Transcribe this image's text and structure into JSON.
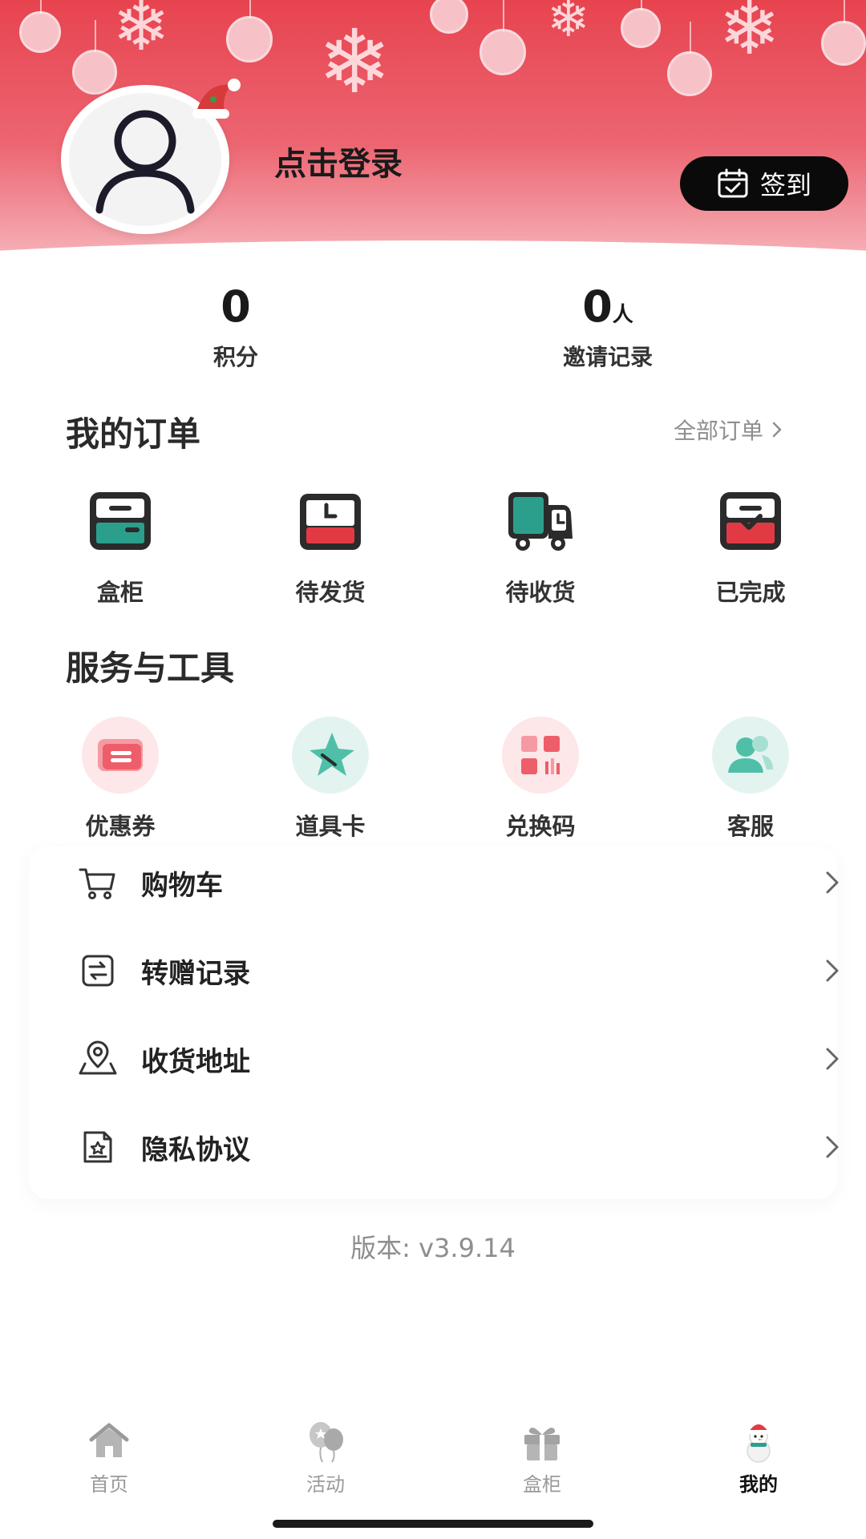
{
  "header": {
    "login_text": "点击登录",
    "checkin_label": "签到"
  },
  "stats": [
    {
      "value": "0",
      "unit": "",
      "label": "积分"
    },
    {
      "value": "0",
      "unit": "人",
      "label": "邀请记录"
    }
  ],
  "orders": {
    "title": "我的订单",
    "all_link": "全部订单",
    "items": [
      {
        "label": "盒柜",
        "icon": "box-cabinet-icon"
      },
      {
        "label": "待发货",
        "icon": "pending-ship-icon"
      },
      {
        "label": "待收货",
        "icon": "delivery-truck-icon"
      },
      {
        "label": "已完成",
        "icon": "completed-box-icon"
      }
    ]
  },
  "services": {
    "title": "服务与工具",
    "items": [
      {
        "label": "优惠券",
        "icon": "coupon-icon"
      },
      {
        "label": "道具卡",
        "icon": "prop-card-icon"
      },
      {
        "label": "兑换码",
        "icon": "redeem-code-icon"
      },
      {
        "label": "客服",
        "icon": "customer-service-icon"
      }
    ]
  },
  "menu": [
    {
      "label": "购物车",
      "icon": "cart-icon"
    },
    {
      "label": "转赠记录",
      "icon": "transfer-icon"
    },
    {
      "label": "收货地址",
      "icon": "location-icon"
    },
    {
      "label": "隐私协议",
      "icon": "privacy-icon"
    }
  ],
  "version": "版本: v3.9.14",
  "tabbar": [
    {
      "label": "首页",
      "icon": "home-icon",
      "active": false
    },
    {
      "label": "活动",
      "icon": "activity-icon",
      "active": false
    },
    {
      "label": "盒柜",
      "icon": "gift-box-icon",
      "active": false
    },
    {
      "label": "我的",
      "icon": "snowman-icon",
      "active": true
    }
  ],
  "colors": {
    "accent_red": "#e7434f",
    "teal": "#2b9f8c",
    "dark": "#111111"
  }
}
